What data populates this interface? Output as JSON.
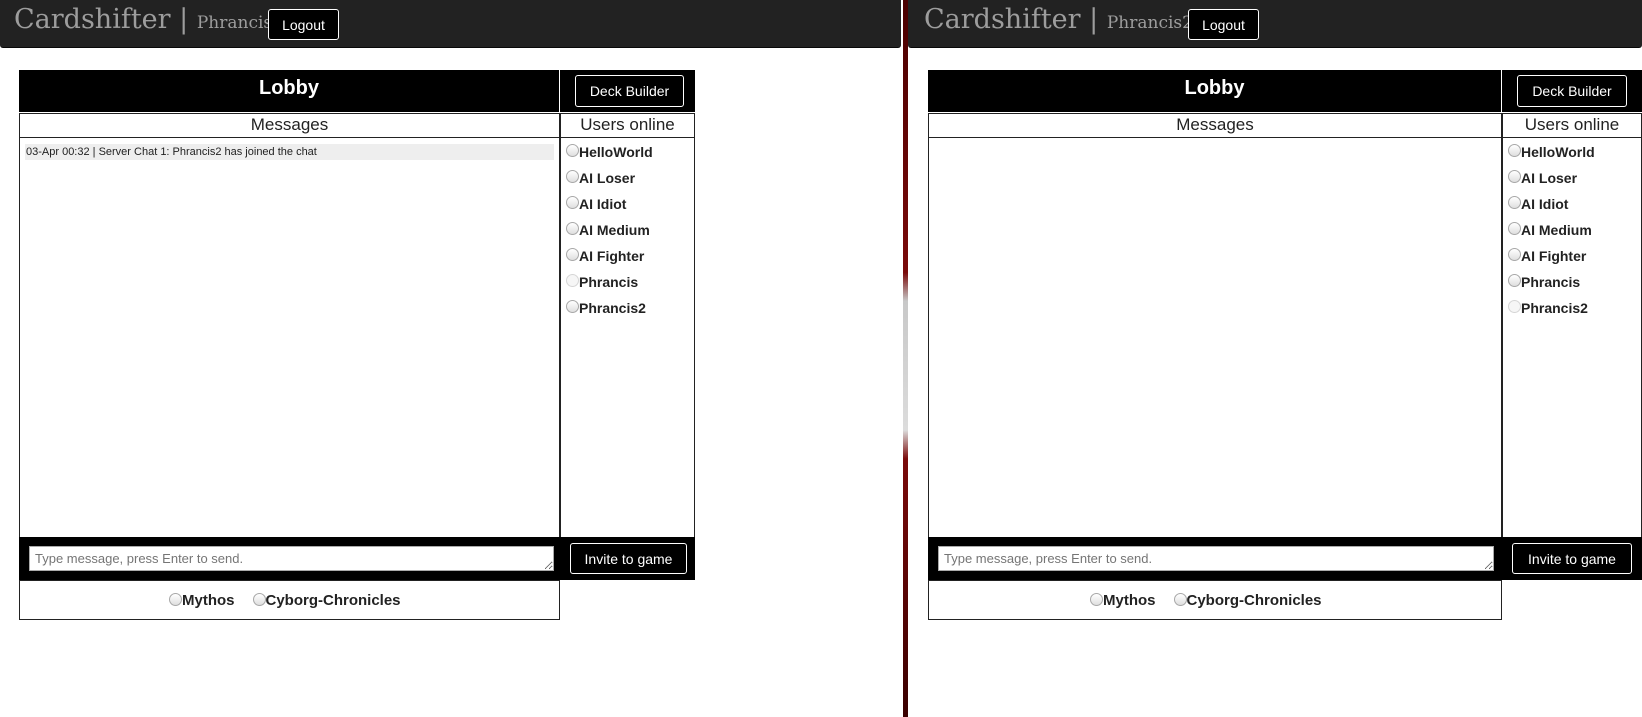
{
  "brand": "Cardshifter",
  "brand_separator": "|",
  "logout_label": "Logout",
  "lobby_title": "Lobby",
  "deck_builder_label": "Deck Builder",
  "messages_header": "Messages",
  "users_header": "Users online",
  "input_placeholder": "Type message, press Enter to send.",
  "invite_label": "Invite to game",
  "decks": [
    "Mythos",
    "Cyborg-Chronicles"
  ],
  "users": [
    "HelloWorld",
    "AI Loser",
    "AI Idiot",
    "AI Medium",
    "AI Fighter",
    "Phrancis",
    "Phrancis2"
  ],
  "left": {
    "username": "Phrancis",
    "messages": [
      "03-Apr 00:32 | Server Chat 1: Phrancis2 has joined the chat"
    ],
    "disabled_user": "Phrancis"
  },
  "right": {
    "username": "Phrancis2",
    "messages": [],
    "disabled_user": "Phrancis2"
  },
  "colors": {
    "navbar_bg": "#222222",
    "brand_text": "#9d9d9d",
    "header_bg": "#000000",
    "message_bg": "#eeeeee",
    "divider": "#7a0a0a"
  }
}
